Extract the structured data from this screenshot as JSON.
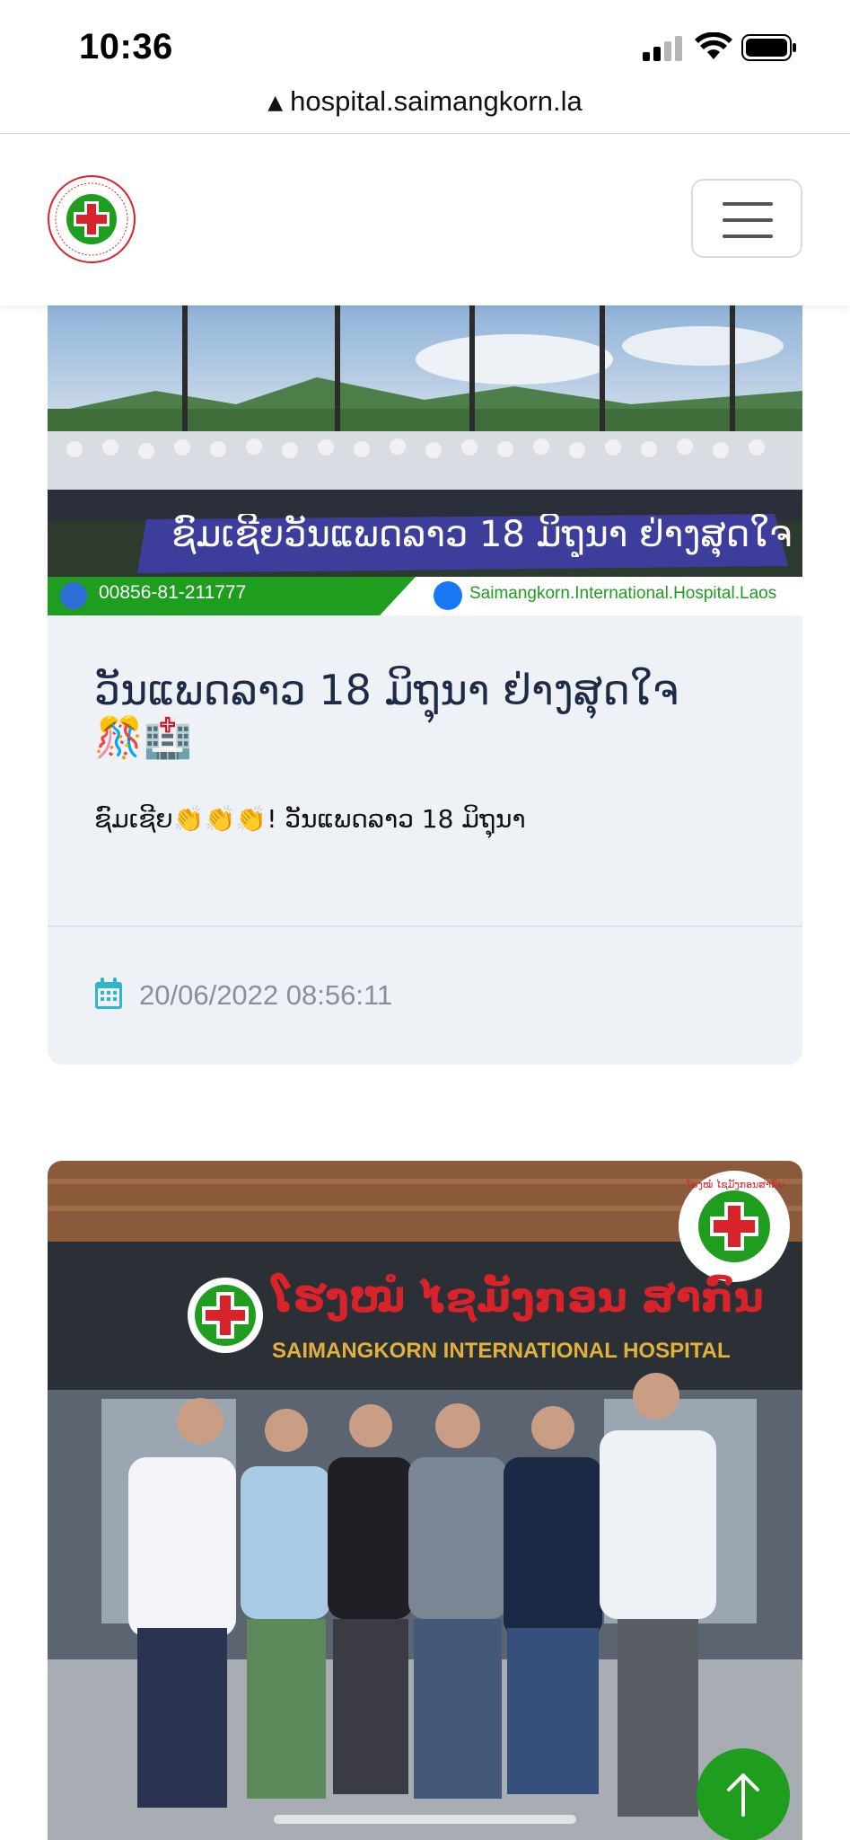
{
  "status_bar": {
    "time": "10:36"
  },
  "browser": {
    "url": "hospital.saimangkorn.la",
    "warning_icon": "warning-triangle-icon"
  },
  "header": {
    "logo_icon": "hospital-logo-icon",
    "menu_icon": "hamburger-menu-icon"
  },
  "posts": [
    {
      "banner_text": "ຊົມເຊີຍວັນແພດລາວ 18 ມິຖຸນາ ຢ່າງສຸດໃຈ",
      "phone": "00856-81-211777",
      "facebook": "Saimangkorn.International.Hospital.Laos",
      "title": "ວັນແພດລາວ 18 ມິຖຸນາ ຢ່າງສຸດໃຈ",
      "title_emojis": "🎊🏥",
      "excerpt": "ຊົມເຊີຍ👏👏👏! ວັນແພດລາວ 18 ມິຖຸນາ",
      "date": "20/06/2022 08:56:11"
    },
    {
      "sign_lao": "ໂຮງໝໍ ໄຊມັງກອນ ສາກົນ",
      "sign_english": "SAIMANGKORN INTERNATIONAL HOSPITAL",
      "badge_text": "ໂຮງໝໍ ໄຊມັງກອນສາກົນ"
    }
  ],
  "colors": {
    "brand_green": "#1f9d1f",
    "brand_red": "#d8232a",
    "card_bg": "#eef1f6",
    "title_text": "#1e2b46"
  }
}
